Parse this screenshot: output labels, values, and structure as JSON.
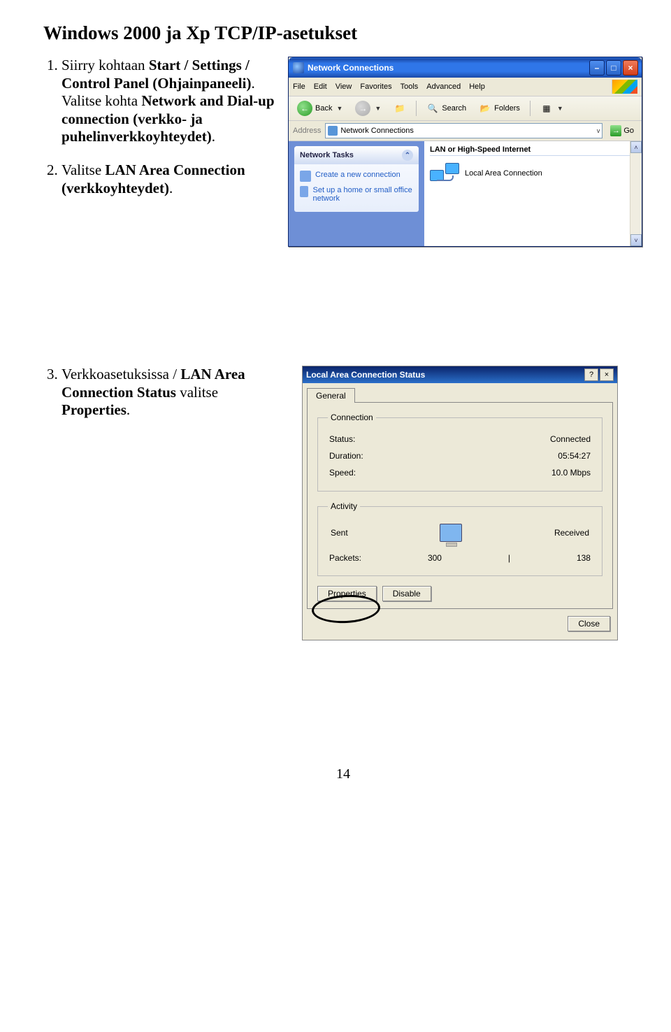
{
  "doc": {
    "title": "Windows 2000 ja Xp TCP/IP-asetukset",
    "page_number": "14"
  },
  "steps": {
    "s1a": "Siirry kohtaan ",
    "s1b": "Start / Settings / Control Panel (Ohjainpaneeli)",
    "s1c": ". Valitse kohta ",
    "s1d": "Network and Dial-up connection (verkko- ja puhelinverkkoyhteydet)",
    "s1e": ".",
    "s2a": "Valitse ",
    "s2b": "LAN Area Connection (verkkoyhteydet)",
    "s2c": ".",
    "s3a": "Verkkoasetuksissa / ",
    "s3b": "LAN Area Connection Status",
    "s3c": " valitse ",
    "s3d": "Properties",
    "s3e": "."
  },
  "win1": {
    "title": "Network Connections",
    "menu": {
      "file": "File",
      "edit": "Edit",
      "view": "View",
      "fav": "Favorites",
      "tools": "Tools",
      "adv": "Advanced",
      "help": "Help"
    },
    "toolbar": {
      "back": "Back",
      "search": "Search",
      "folders": "Folders"
    },
    "address_label": "Address",
    "address_value": "Network Connections",
    "go": "Go",
    "tasks_header": "Network Tasks",
    "tasks": [
      "Create a new connection",
      "Set up a home or small office network"
    ],
    "group": "LAN or High-Speed Internet",
    "item": "Local Area Connection"
  },
  "win2": {
    "title": "Local Area Connection Status",
    "tab": "General",
    "grp_conn": "Connection",
    "status_l": "Status:",
    "status_v": "Connected",
    "dur_l": "Duration:",
    "dur_v": "05:54:27",
    "speed_l": "Speed:",
    "speed_v": "10.0 Mbps",
    "grp_act": "Activity",
    "sent": "Sent",
    "recv": "Received",
    "pkts_l": "Packets:",
    "pkts_sent": "300",
    "pkts_sep": "|",
    "pkts_recv": "138",
    "btn_props": "Properties",
    "btn_disable": "Disable",
    "btn_close": "Close"
  }
}
